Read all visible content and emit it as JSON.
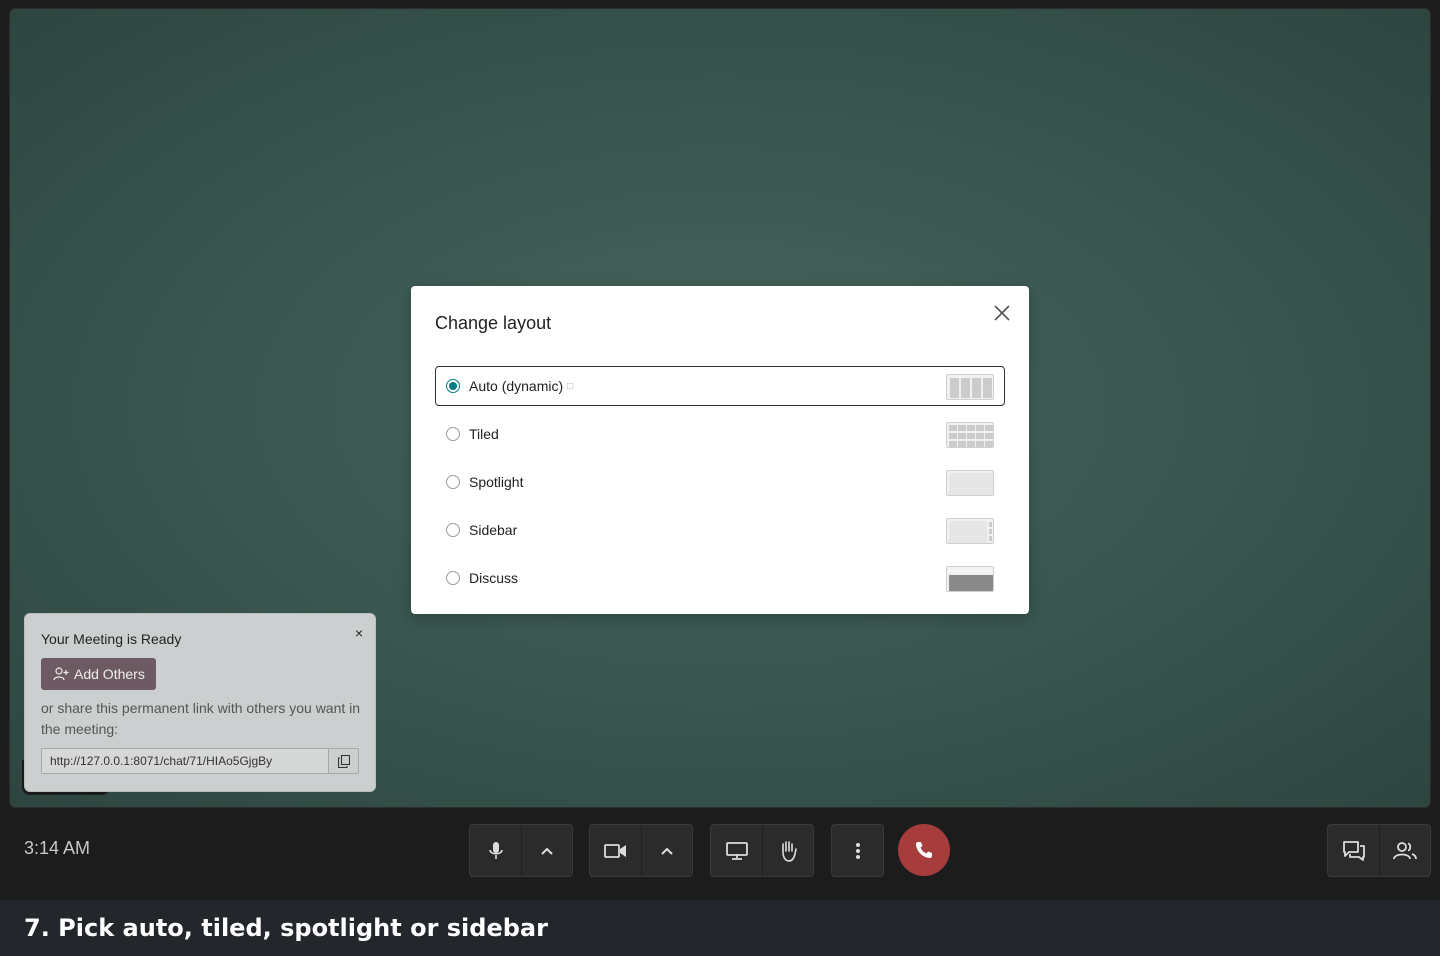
{
  "modal": {
    "title": "Change layout",
    "options": [
      {
        "label": "Auto (dynamic)",
        "selected": true,
        "info_glyph": "□"
      },
      {
        "label": "Tiled",
        "selected": false
      },
      {
        "label": "Spotlight",
        "selected": false
      },
      {
        "label": "Sidebar",
        "selected": false
      },
      {
        "label": "Discuss",
        "selected": false
      }
    ]
  },
  "popup": {
    "title": "Your Meeting is Ready",
    "close_glyph": "×",
    "add_button": "Add Others",
    "share_text": "or share this permanent link with others you want in the meeting:",
    "link": "http://127.0.0.1:8071/chat/71/HIAo5GjgBy"
  },
  "controls": {
    "time": "3:14 AM",
    "icons": [
      "microphone-icon",
      "chevron-up-icon",
      "camera-icon",
      "chevron-up-icon",
      "screen-share-icon",
      "raise-hand-icon",
      "more-vertical-icon",
      "hang-up-icon",
      "chat-icon",
      "participants-icon"
    ]
  },
  "caption": "7. Pick auto, tiled, spotlight or sidebar",
  "colors": {
    "accent": "#017e84",
    "hangup": "#a73c3c",
    "add_button": "#6e5a63"
  }
}
